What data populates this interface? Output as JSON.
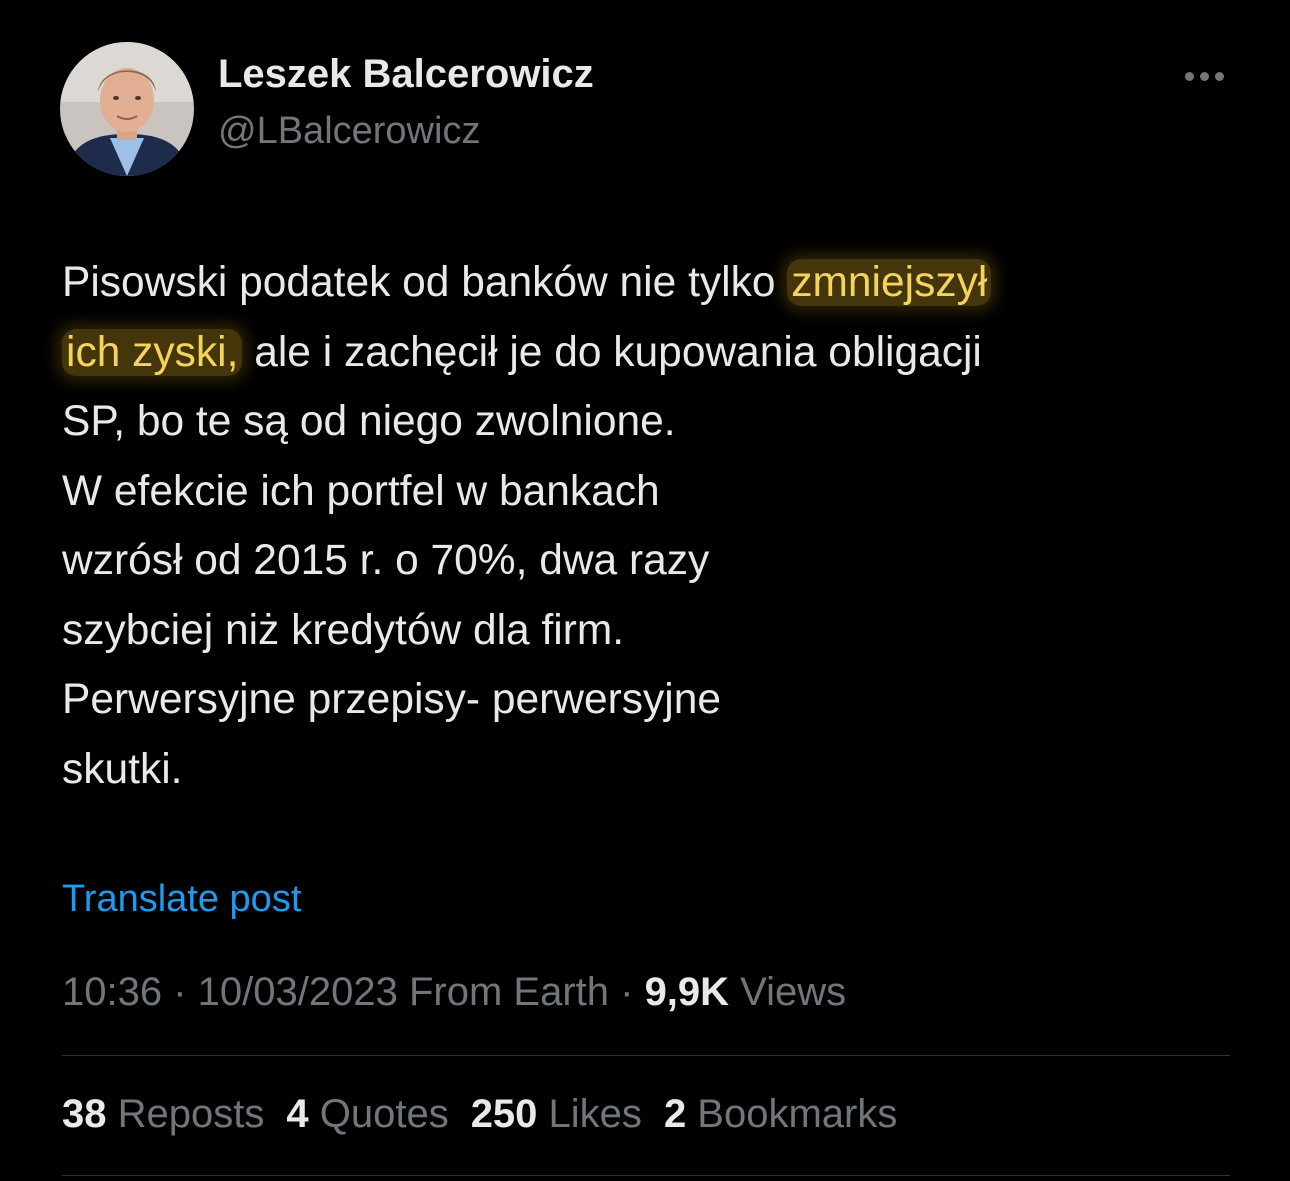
{
  "author": {
    "name": "Leszek Balcerowicz",
    "handle": "@LBalcerowicz"
  },
  "post": {
    "lines": [
      {
        "before": "Pisowski podatek od banków nie tylko ",
        "highlight": "zmniejszył",
        "after": ""
      },
      {
        "before": "",
        "highlight": "ich zyski,",
        "after": " ale i zachęcił je do kupowania obligacji"
      },
      {
        "before": "SP, bo te są od niego zwolnione.",
        "highlight": "",
        "after": ""
      },
      {
        "before": "W efekcie ich portfel w bankach",
        "highlight": "",
        "after": ""
      },
      {
        "before": "wzrósł od 2015 r. o 70%, dwa razy",
        "highlight": "",
        "after": ""
      },
      {
        "before": "szybciej niż kredytów dla firm.",
        "highlight": "",
        "after": ""
      },
      {
        "before": "Perwersyjne przepisy- perwersyjne",
        "highlight": "",
        "after": ""
      },
      {
        "before": "skutki.",
        "highlight": "",
        "after": ""
      }
    ],
    "translate_label": "Translate post"
  },
  "meta": {
    "time": "10:36",
    "separator": " · ",
    "date": "10/03/2023",
    "source": " From Earth",
    "views_count": "9,9K",
    "views_label": " Views"
  },
  "stats": [
    {
      "count": "38",
      "label": " Reposts"
    },
    {
      "count": "4",
      "label": " Quotes"
    },
    {
      "count": "250",
      "label": " Likes"
    },
    {
      "count": "2",
      "label": " Bookmarks"
    }
  ],
  "icons": {
    "more": "more-horizontal-icon",
    "avatar": "avatar-photo"
  },
  "colors": {
    "background": "#000000",
    "text": "#e7e9ea",
    "muted": "#71767b",
    "link": "#1d9bf0",
    "highlight_text": "#f4d35e",
    "divider": "#2f3336"
  }
}
